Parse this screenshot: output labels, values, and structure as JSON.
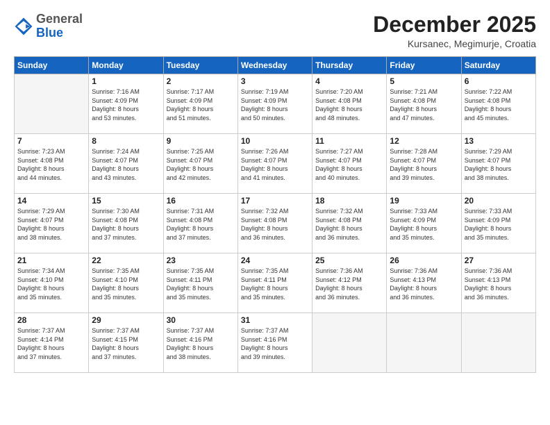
{
  "logo": {
    "general": "General",
    "blue": "Blue"
  },
  "header": {
    "title": "December 2025",
    "location": "Kursanec, Megimurje, Croatia"
  },
  "days_of_week": [
    "Sunday",
    "Monday",
    "Tuesday",
    "Wednesday",
    "Thursday",
    "Friday",
    "Saturday"
  ],
  "weeks": [
    [
      {
        "day": "",
        "info": ""
      },
      {
        "day": "1",
        "info": "Sunrise: 7:16 AM\nSunset: 4:09 PM\nDaylight: 8 hours\nand 53 minutes."
      },
      {
        "day": "2",
        "info": "Sunrise: 7:17 AM\nSunset: 4:09 PM\nDaylight: 8 hours\nand 51 minutes."
      },
      {
        "day": "3",
        "info": "Sunrise: 7:19 AM\nSunset: 4:09 PM\nDaylight: 8 hours\nand 50 minutes."
      },
      {
        "day": "4",
        "info": "Sunrise: 7:20 AM\nSunset: 4:08 PM\nDaylight: 8 hours\nand 48 minutes."
      },
      {
        "day": "5",
        "info": "Sunrise: 7:21 AM\nSunset: 4:08 PM\nDaylight: 8 hours\nand 47 minutes."
      },
      {
        "day": "6",
        "info": "Sunrise: 7:22 AM\nSunset: 4:08 PM\nDaylight: 8 hours\nand 45 minutes."
      }
    ],
    [
      {
        "day": "7",
        "info": "Sunrise: 7:23 AM\nSunset: 4:08 PM\nDaylight: 8 hours\nand 44 minutes."
      },
      {
        "day": "8",
        "info": "Sunrise: 7:24 AM\nSunset: 4:07 PM\nDaylight: 8 hours\nand 43 minutes."
      },
      {
        "day": "9",
        "info": "Sunrise: 7:25 AM\nSunset: 4:07 PM\nDaylight: 8 hours\nand 42 minutes."
      },
      {
        "day": "10",
        "info": "Sunrise: 7:26 AM\nSunset: 4:07 PM\nDaylight: 8 hours\nand 41 minutes."
      },
      {
        "day": "11",
        "info": "Sunrise: 7:27 AM\nSunset: 4:07 PM\nDaylight: 8 hours\nand 40 minutes."
      },
      {
        "day": "12",
        "info": "Sunrise: 7:28 AM\nSunset: 4:07 PM\nDaylight: 8 hours\nand 39 minutes."
      },
      {
        "day": "13",
        "info": "Sunrise: 7:29 AM\nSunset: 4:07 PM\nDaylight: 8 hours\nand 38 minutes."
      }
    ],
    [
      {
        "day": "14",
        "info": "Sunrise: 7:29 AM\nSunset: 4:07 PM\nDaylight: 8 hours\nand 38 minutes."
      },
      {
        "day": "15",
        "info": "Sunrise: 7:30 AM\nSunset: 4:08 PM\nDaylight: 8 hours\nand 37 minutes."
      },
      {
        "day": "16",
        "info": "Sunrise: 7:31 AM\nSunset: 4:08 PM\nDaylight: 8 hours\nand 37 minutes."
      },
      {
        "day": "17",
        "info": "Sunrise: 7:32 AM\nSunset: 4:08 PM\nDaylight: 8 hours\nand 36 minutes."
      },
      {
        "day": "18",
        "info": "Sunrise: 7:32 AM\nSunset: 4:08 PM\nDaylight: 8 hours\nand 36 minutes."
      },
      {
        "day": "19",
        "info": "Sunrise: 7:33 AM\nSunset: 4:09 PM\nDaylight: 8 hours\nand 35 minutes."
      },
      {
        "day": "20",
        "info": "Sunrise: 7:33 AM\nSunset: 4:09 PM\nDaylight: 8 hours\nand 35 minutes."
      }
    ],
    [
      {
        "day": "21",
        "info": "Sunrise: 7:34 AM\nSunset: 4:10 PM\nDaylight: 8 hours\nand 35 minutes."
      },
      {
        "day": "22",
        "info": "Sunrise: 7:35 AM\nSunset: 4:10 PM\nDaylight: 8 hours\nand 35 minutes."
      },
      {
        "day": "23",
        "info": "Sunrise: 7:35 AM\nSunset: 4:11 PM\nDaylight: 8 hours\nand 35 minutes."
      },
      {
        "day": "24",
        "info": "Sunrise: 7:35 AM\nSunset: 4:11 PM\nDaylight: 8 hours\nand 35 minutes."
      },
      {
        "day": "25",
        "info": "Sunrise: 7:36 AM\nSunset: 4:12 PM\nDaylight: 8 hours\nand 36 minutes."
      },
      {
        "day": "26",
        "info": "Sunrise: 7:36 AM\nSunset: 4:13 PM\nDaylight: 8 hours\nand 36 minutes."
      },
      {
        "day": "27",
        "info": "Sunrise: 7:36 AM\nSunset: 4:13 PM\nDaylight: 8 hours\nand 36 minutes."
      }
    ],
    [
      {
        "day": "28",
        "info": "Sunrise: 7:37 AM\nSunset: 4:14 PM\nDaylight: 8 hours\nand 37 minutes."
      },
      {
        "day": "29",
        "info": "Sunrise: 7:37 AM\nSunset: 4:15 PM\nDaylight: 8 hours\nand 37 minutes."
      },
      {
        "day": "30",
        "info": "Sunrise: 7:37 AM\nSunset: 4:16 PM\nDaylight: 8 hours\nand 38 minutes."
      },
      {
        "day": "31",
        "info": "Sunrise: 7:37 AM\nSunset: 4:16 PM\nDaylight: 8 hours\nand 39 minutes."
      },
      {
        "day": "",
        "info": ""
      },
      {
        "day": "",
        "info": ""
      },
      {
        "day": "",
        "info": ""
      }
    ]
  ]
}
